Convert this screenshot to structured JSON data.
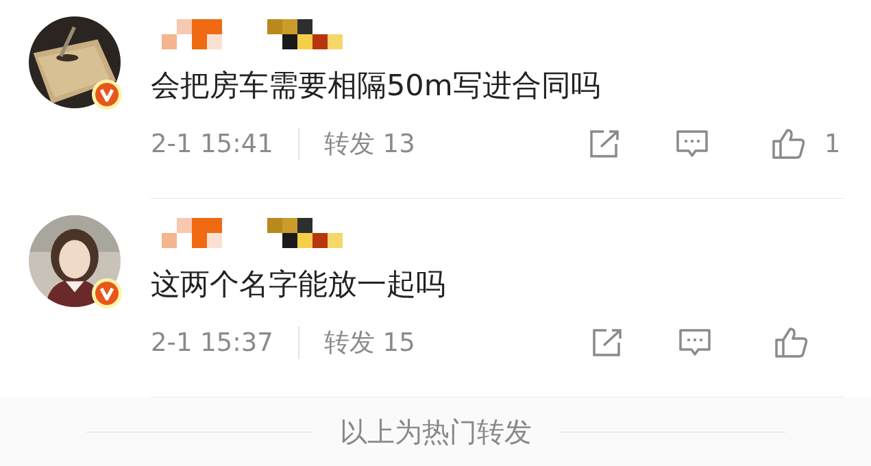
{
  "comments": [
    {
      "text": "会把房车需要相隔50m写进合同吗",
      "time": "2-1 15:41",
      "reposts": "转发 13",
      "likes": "1"
    },
    {
      "text": "这两个名字能放一起吗",
      "time": "2-1 15:37",
      "reposts": "转发 15"
    }
  ],
  "footer": {
    "text": "以上为热门转发"
  }
}
